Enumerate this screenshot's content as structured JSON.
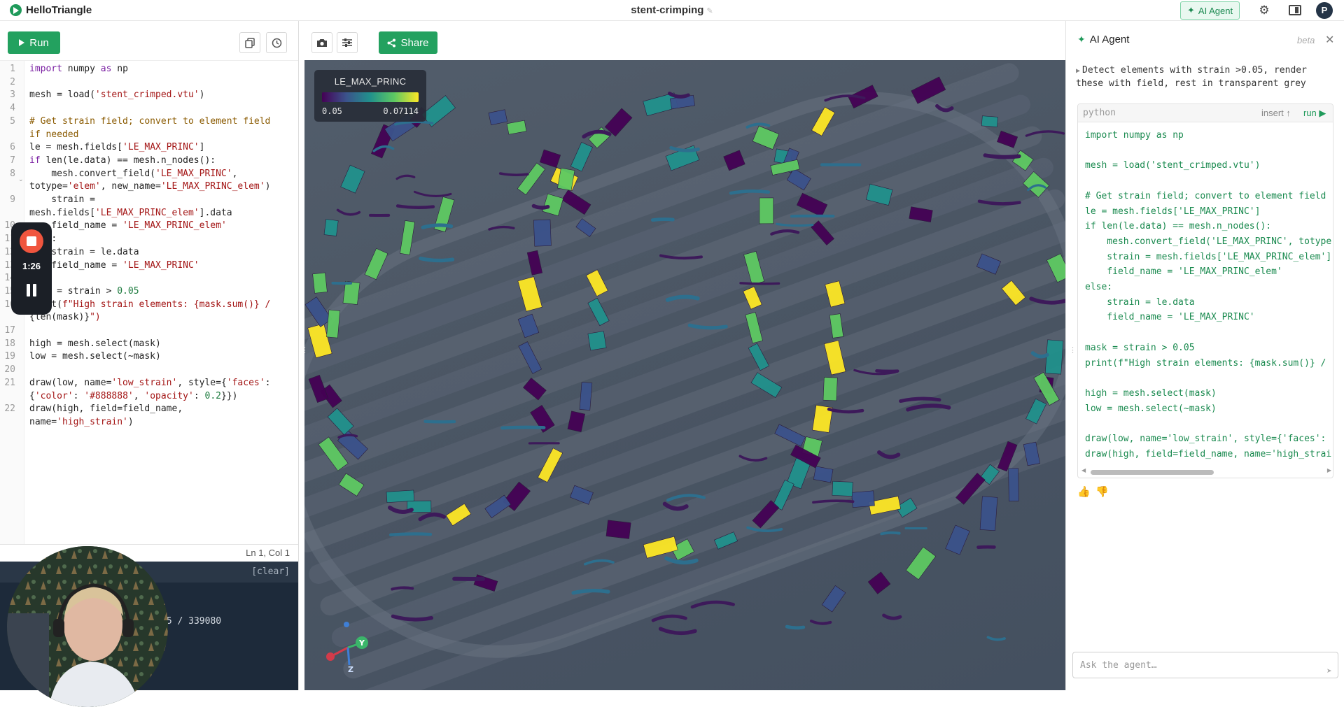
{
  "app": {
    "name": "HelloTriangle",
    "doc_title": "stent-crimping",
    "ai_agent_label": "AI Agent",
    "avatar_letter": "P"
  },
  "editor": {
    "run_label": "Run",
    "status": "Ln 1, Col 1",
    "lines": [
      {
        "n": "1",
        "t": "import numpy as np"
      },
      {
        "n": "2",
        "t": ""
      },
      {
        "n": "3",
        "t": "mesh = load('stent_crimped.vtu')"
      },
      {
        "n": "4",
        "t": ""
      },
      {
        "n": "5",
        "t": "# Get strain field; convert to element field"
      },
      {
        "n": "",
        "t": "if needed"
      },
      {
        "n": "6",
        "t": "le = mesh.fields['LE_MAX_PRINC']"
      },
      {
        "n": "7",
        "t": "if len(le.data) == mesh.n_nodes():"
      },
      {
        "n": "8",
        "t": "    mesh.convert_field('LE_MAX_PRINC',"
      },
      {
        "n": "",
        "t": "totype='elem', new_name='LE_MAX_PRINC_elem')"
      },
      {
        "n": "9",
        "t": "    strain ="
      },
      {
        "n": "",
        "t": "mesh.fields['LE_MAX_PRINC_elem'].data"
      },
      {
        "n": "10",
        "t": "    field_name = 'LE_MAX_PRINC_elem'"
      },
      {
        "n": "11",
        "t": "else:"
      },
      {
        "n": "12",
        "t": "    strain = le.data"
      },
      {
        "n": "13",
        "t": "    field_name = 'LE_MAX_PRINC'"
      },
      {
        "n": "14",
        "t": ""
      },
      {
        "n": "15",
        "t": "mask = strain > 0.05"
      },
      {
        "n": "16",
        "t": "print(f\"High strain elements: {mask.sum()} /"
      },
      {
        "n": "",
        "t": "{len(mask)}\")"
      },
      {
        "n": "17",
        "t": ""
      },
      {
        "n": "18",
        "t": "high = mesh.select(mask)"
      },
      {
        "n": "19",
        "t": "low = mesh.select(~mask)"
      },
      {
        "n": "20",
        "t": ""
      },
      {
        "n": "21",
        "t": "draw(low, name='low_strain', style={'faces':"
      },
      {
        "n": "",
        "t": "{'color': '#888888', 'opacity': 0.2}})"
      },
      {
        "n": "22",
        "t": "draw(high, field=field_name,"
      },
      {
        "n": "",
        "t": "name='high_strain')"
      }
    ]
  },
  "console": {
    "clear_label": "[clear]",
    "output": "55 / 339080"
  },
  "recorder": {
    "time": "1:26"
  },
  "viewport": {
    "share_label": "Share",
    "legend": {
      "title": "LE_MAX_PRINC",
      "min": "0.05",
      "max": "0.07114"
    },
    "axes": {
      "y": "Y",
      "z": "Z"
    },
    "colors": {
      "viridis": [
        "#440154",
        "#3b528b",
        "#21918c",
        "#5ec962",
        "#fde725"
      ],
      "background": "#4b5665"
    }
  },
  "ai_panel": {
    "title": "AI Agent",
    "beta": "beta",
    "prompt": "Detect elements with strain >0.05, render these with field, rest in transparent grey",
    "code_lang": "python",
    "insert_label": "insert ↑",
    "run_label": "run ▶",
    "code_lines": [
      "import numpy as np",
      "",
      "mesh = load('stent_crimped.vtu')",
      "",
      "# Get strain field; convert to element field",
      "le = mesh.fields['LE_MAX_PRINC']",
      "if len(le.data) == mesh.n_nodes():",
      "    mesh.convert_field('LE_MAX_PRINC', totype",
      "    strain = mesh.fields['LE_MAX_PRINC_elem']",
      "    field_name = 'LE_MAX_PRINC_elem'",
      "else:",
      "    strain = le.data",
      "    field_name = 'LE_MAX_PRINC'",
      "",
      "mask = strain > 0.05",
      "print(f\"High strain elements: {mask.sum()} /",
      "",
      "high = mesh.select(mask)",
      "low = mesh.select(~mask)",
      "",
      "draw(low, name='low_strain', style={'faces':",
      "draw(high, field=field_name, name='high_strai"
    ],
    "input_placeholder": "Ask the agent…"
  },
  "icons": {
    "thumbs_up": "👍",
    "thumbs_down": "👎"
  }
}
